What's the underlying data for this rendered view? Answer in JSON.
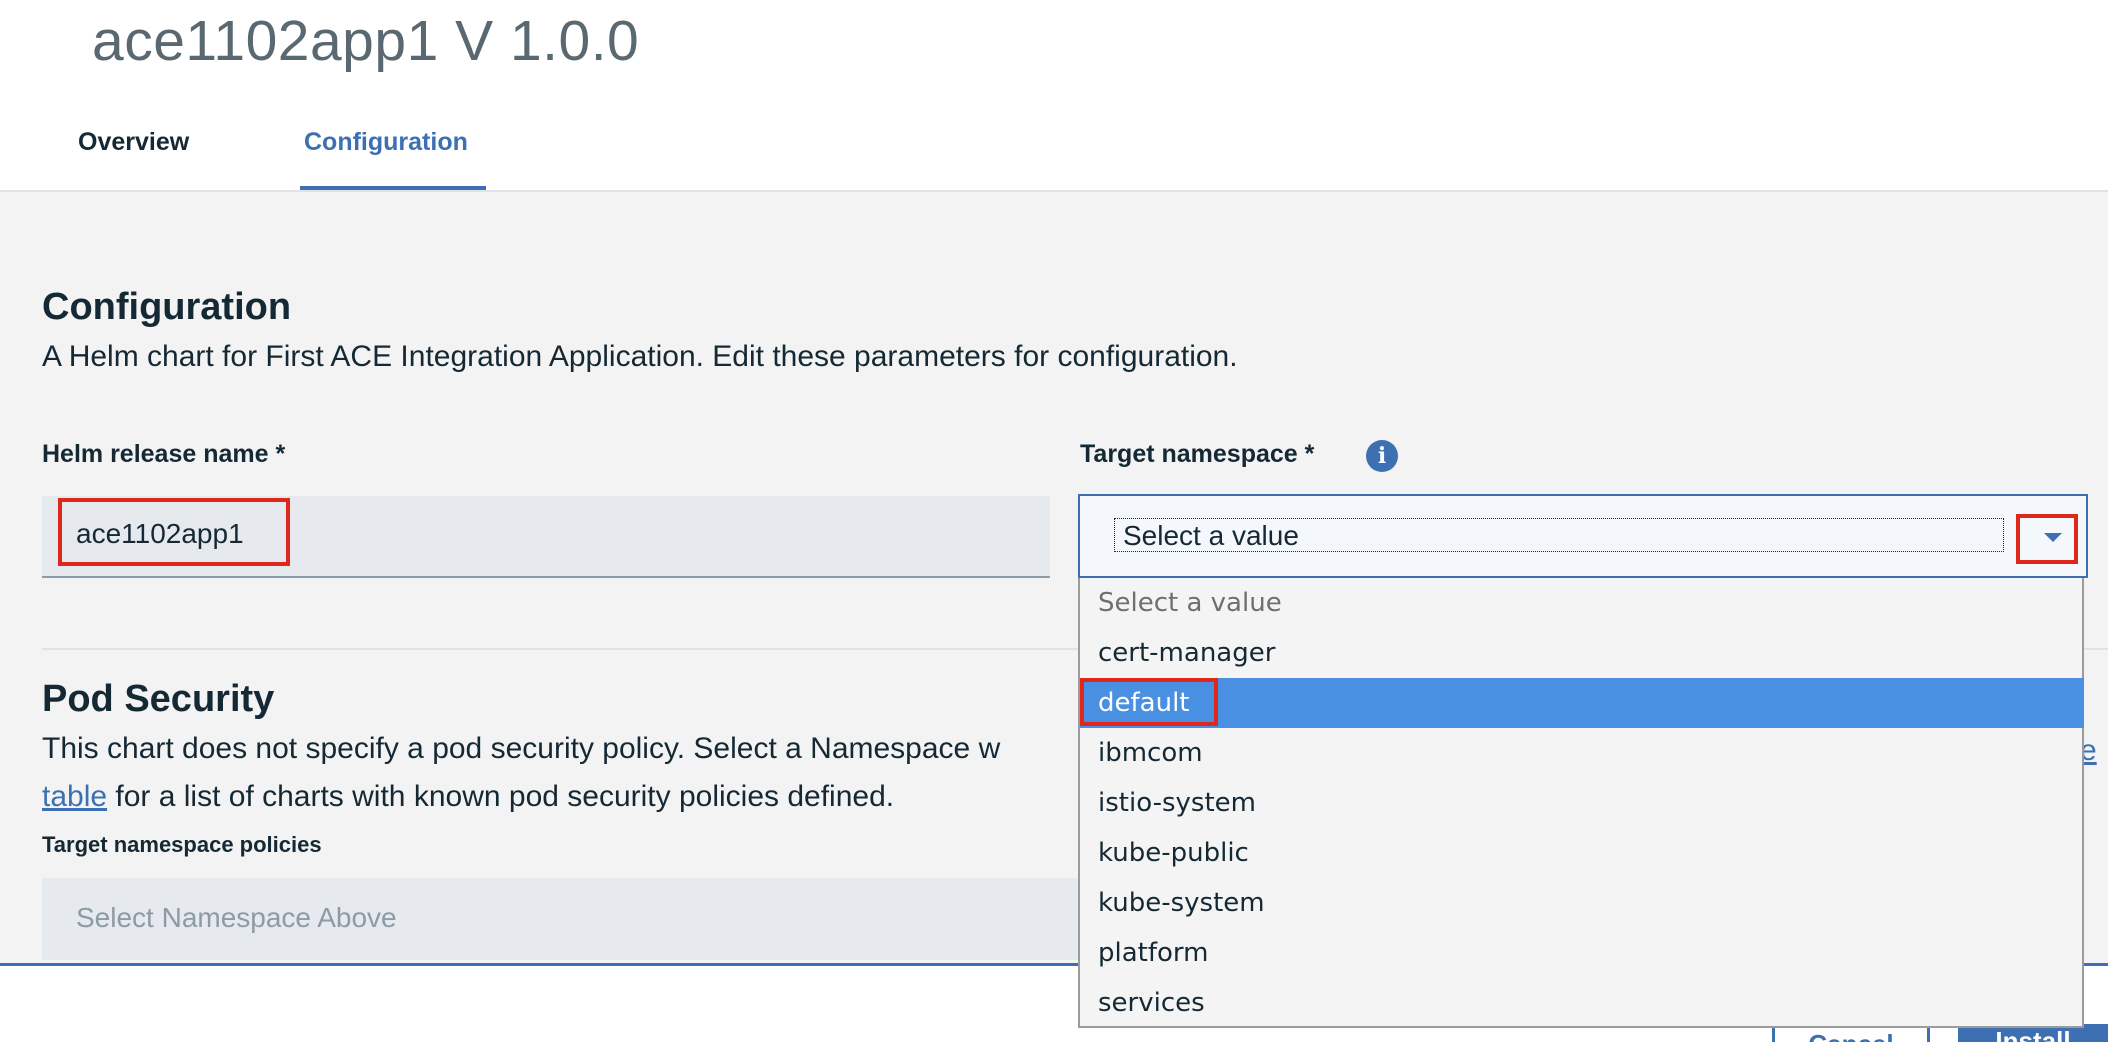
{
  "header": {
    "app_title": "ace1102app1 V 1.0.0",
    "tabs": [
      {
        "label": "Overview",
        "active": false
      },
      {
        "label": "Configuration",
        "active": true
      }
    ]
  },
  "configuration": {
    "title": "Configuration",
    "description": "A Helm chart for First ACE Integration Application. Edit these parameters for configuration.",
    "release_name_label": "Helm release name *",
    "release_name_value": "ace1102app1",
    "target_namespace_label": "Target namespace *",
    "target_namespace_value": "Select a value",
    "namespace_options": [
      "Select a value",
      "cert-manager",
      "default",
      "ibmcom",
      "istio-system",
      "kube-public",
      "kube-system",
      "platform",
      "services"
    ],
    "highlighted_option": "default"
  },
  "pod_security": {
    "title": "Pod Security",
    "desc_line1": "This chart does not specify a pod security policy. Select a Namespace w",
    "desc_link_edge": "e",
    "desc_link": "table",
    "desc_line2_rest": " for a list of charts with known pod security policies defined.",
    "policies_label": "Target namespace policies",
    "policies_placeholder": "Select Namespace Above"
  },
  "footer": {
    "cancel_label": "Cancel",
    "install_label": "Install"
  },
  "colors": {
    "accent": "#3d70b2",
    "highlight": "#4a90e2",
    "annotation_red": "#e0271e"
  }
}
